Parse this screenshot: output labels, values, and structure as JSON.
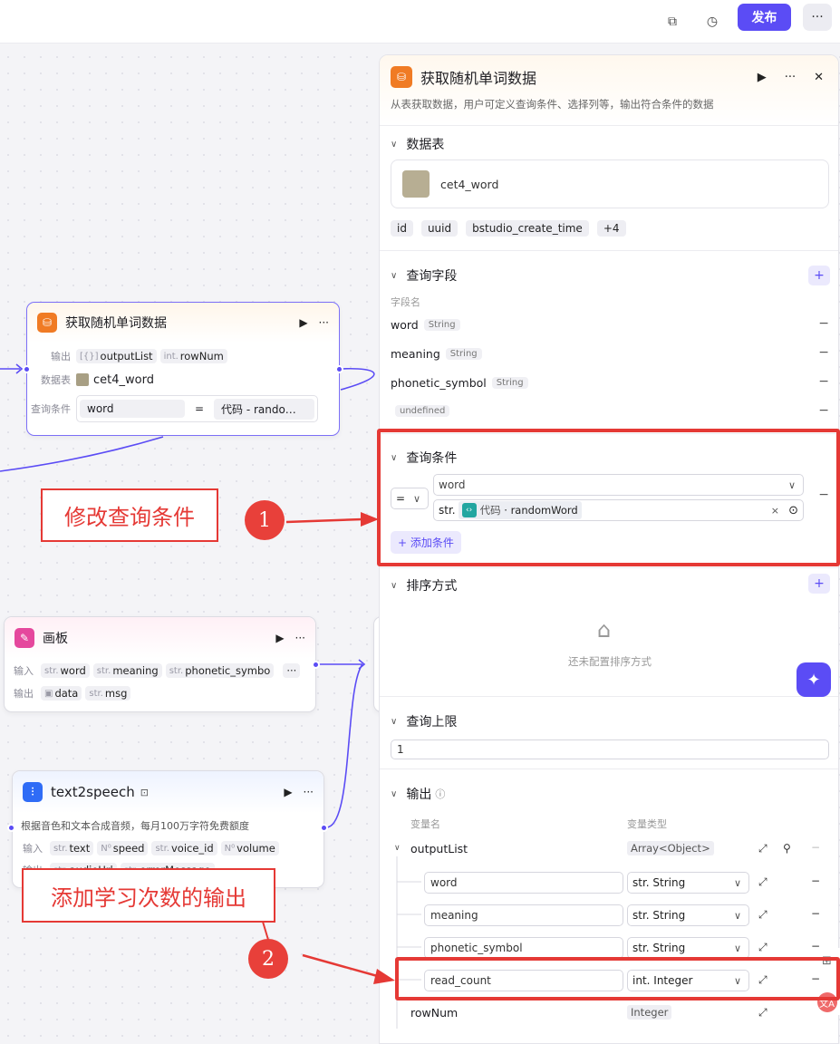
{
  "topbar": {
    "publish": "发布",
    "more": "···"
  },
  "node_db": {
    "title": "获取随机单词数据",
    "output_label": "输出",
    "output_items": [
      {
        "type": "[{}]",
        "name": "outputList"
      },
      {
        "type": "int.",
        "name": "rowNum"
      }
    ],
    "table_label": "数据表",
    "table_name": "cet4_word",
    "cond_label": "查询条件",
    "cond_field": "word",
    "cond_op": "=",
    "cond_value": "代码 - rando…"
  },
  "node_canvas": {
    "title": "画板",
    "input_label": "输入",
    "inputs": [
      {
        "type": "str.",
        "name": "word"
      },
      {
        "type": "str.",
        "name": "meaning"
      },
      {
        "type": "str.",
        "name": "phonetic_symbo"
      }
    ],
    "output_label": "输出",
    "outputs": [
      {
        "type": "img",
        "name": "data"
      },
      {
        "type": "str.",
        "name": "msg"
      }
    ],
    "more": "···"
  },
  "node_tts": {
    "title": "text2speech",
    "desc": "根据音色和文本合成音频，每月100万字符免费额度",
    "input_label": "输入",
    "inputs": [
      {
        "type": "str.",
        "name": "text"
      },
      {
        "type": "N⁰",
        "name": "speed"
      },
      {
        "type": "str.",
        "name": "voice_id"
      },
      {
        "type": "N⁰",
        "name": "volume"
      }
    ],
    "output_label": "输出",
    "outputs": [
      {
        "type": "str.",
        "name": "audioUrl"
      },
      {
        "type": "str.",
        "name": "errorMessage"
      }
    ]
  },
  "panel": {
    "title": "获取随机单词数据",
    "desc": "从表获取数据，用户可定义查询条件、选择列等，输出符合条件的数据",
    "table_section": "数据表",
    "table_name": "cet4_word",
    "columns": [
      "id",
      "uuid",
      "bstudio_create_time",
      "+4"
    ],
    "fields_section": "查询字段",
    "fields_header": "字段名",
    "fields": [
      {
        "name": "word",
        "type": "String"
      },
      {
        "name": "meaning",
        "type": "String"
      },
      {
        "name": "phonetic_symbol",
        "type": "String"
      },
      {
        "name": "",
        "type": "undefined"
      }
    ],
    "cond_section": "查询条件",
    "cond_op": "=",
    "cond_field": "word",
    "cond_type": "str.",
    "cond_value_prefix": "代码",
    "cond_value": "· randomWord",
    "cond_close": "×",
    "add_cond": "+ 添加条件",
    "sort_section": "排序方式",
    "sort_empty": "还未配置排序方式",
    "limit_section": "查询上限",
    "limit_value": "1",
    "output_section": "输出",
    "var_name_header": "变量名",
    "var_type_header": "变量类型",
    "output_list": {
      "name": "outputList",
      "type": "Array<Object>"
    },
    "output_children": [
      {
        "name": "word",
        "type": "str. String"
      },
      {
        "name": "meaning",
        "type": "str. String"
      },
      {
        "name": "phonetic_symbol",
        "type": "str. String"
      },
      {
        "name": "read_count",
        "type": "int. Integer"
      }
    ],
    "rownum": {
      "name": "rowNum",
      "type": "Integer"
    }
  },
  "annotations": {
    "a1_text": "修改查询条件",
    "a1_num": "1",
    "a2_text": "添加学习次数的输出",
    "a2_num": "2"
  },
  "colors": {
    "accent": "#5b4cf5",
    "annotation_red": "#e53935",
    "db_icon": "#f07b24",
    "canvas_icon": "#e5489d",
    "tts_icon": "#2f6cf6"
  }
}
